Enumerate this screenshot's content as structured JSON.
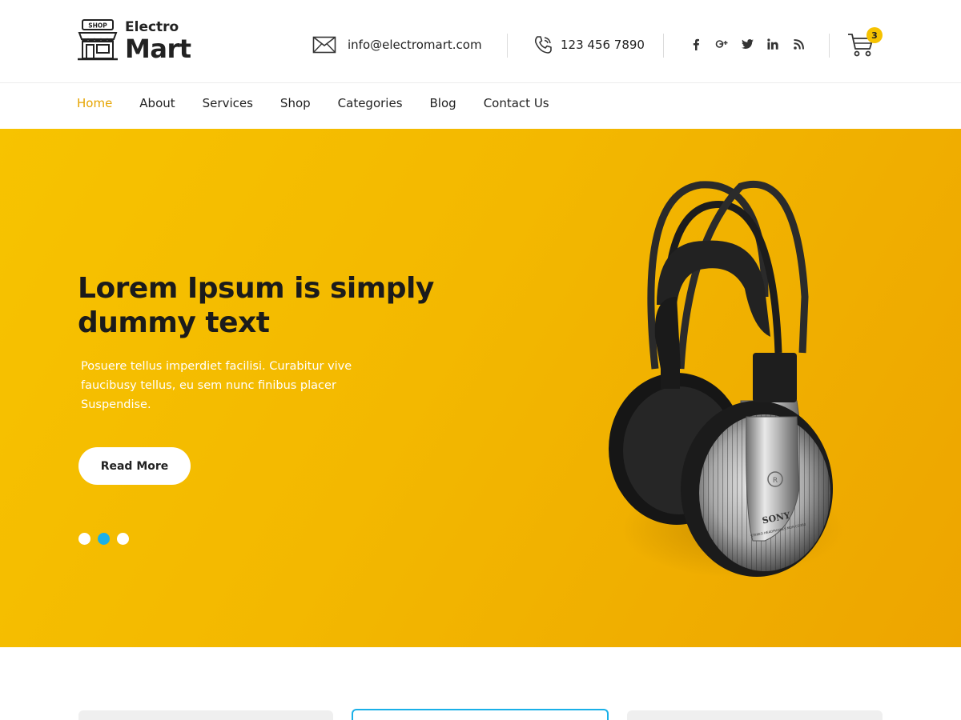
{
  "brand": {
    "logo_sign": "SHOP",
    "name_small": "Electro",
    "name_big": "Mart"
  },
  "header": {
    "email": "info@electromart.com",
    "phone": "123 456 7890",
    "socials": [
      {
        "name": "facebook-icon",
        "glyph": "f"
      },
      {
        "name": "google-plus-icon",
        "glyph": "g+"
      },
      {
        "name": "twitter-icon",
        "glyph": "t"
      },
      {
        "name": "linkedin-icon",
        "glyph": "in"
      },
      {
        "name": "rss-icon",
        "glyph": "rss"
      }
    ],
    "cart_count": "3"
  },
  "nav": {
    "items": [
      "Home",
      "About",
      "Services",
      "Shop",
      "Categories",
      "Blog",
      "Contact Us"
    ],
    "active": "Home"
  },
  "hero": {
    "title": "Lorem Ipsum is simply dummy text",
    "text": "Posuere tellus imperdiet facilisi. Curabitur vive faucibusy tellus, eu sem nunc finibus placer Suspendise.",
    "button_label": "Read More",
    "slide_count": 3,
    "active_slide": 2,
    "product_brand": "SONY",
    "product_model": "STEREO HEADPHONES MDR-CD380"
  },
  "colors": {
    "accent": "#f6c200",
    "nav_active": "#e6a400",
    "slider_dot_active": "#1ab0e8",
    "card_highlight": "#1ab0e8"
  }
}
